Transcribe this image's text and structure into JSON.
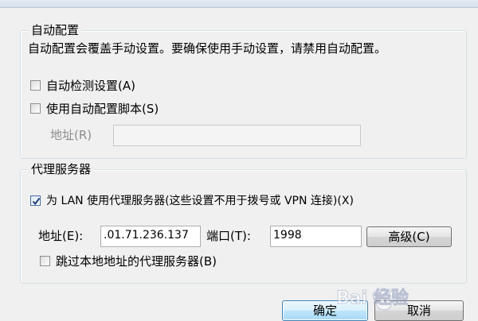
{
  "auto_config": {
    "group_title": "自动配置",
    "description": "自动配置会覆盖手动设置。要确保使用手动设置，请禁用自动配置。",
    "auto_detect": {
      "label": "自动检测设置(A)",
      "checked": false
    },
    "use_script": {
      "label": "使用自动配置脚本(S)",
      "checked": false
    },
    "address_label": "地址(R)",
    "address_value": ""
  },
  "proxy": {
    "group_title": "代理服务器",
    "use_proxy": {
      "label": "为 LAN 使用代理服务器(这些设置不用于拨号或 VPN 连接)(X)",
      "checked": true
    },
    "address_label": "地址(E):",
    "address_value": ".01.71.236.137",
    "port_label": "端口(T):",
    "port_value": "1998",
    "advanced_label": "高级(C)",
    "bypass_local": {
      "label": "跳过本地地址的代理服务器(B)",
      "checked": false
    }
  },
  "footer": {
    "ok_label": "确定",
    "cancel_label": "取消"
  },
  "watermark_text": "Bai 经验"
}
